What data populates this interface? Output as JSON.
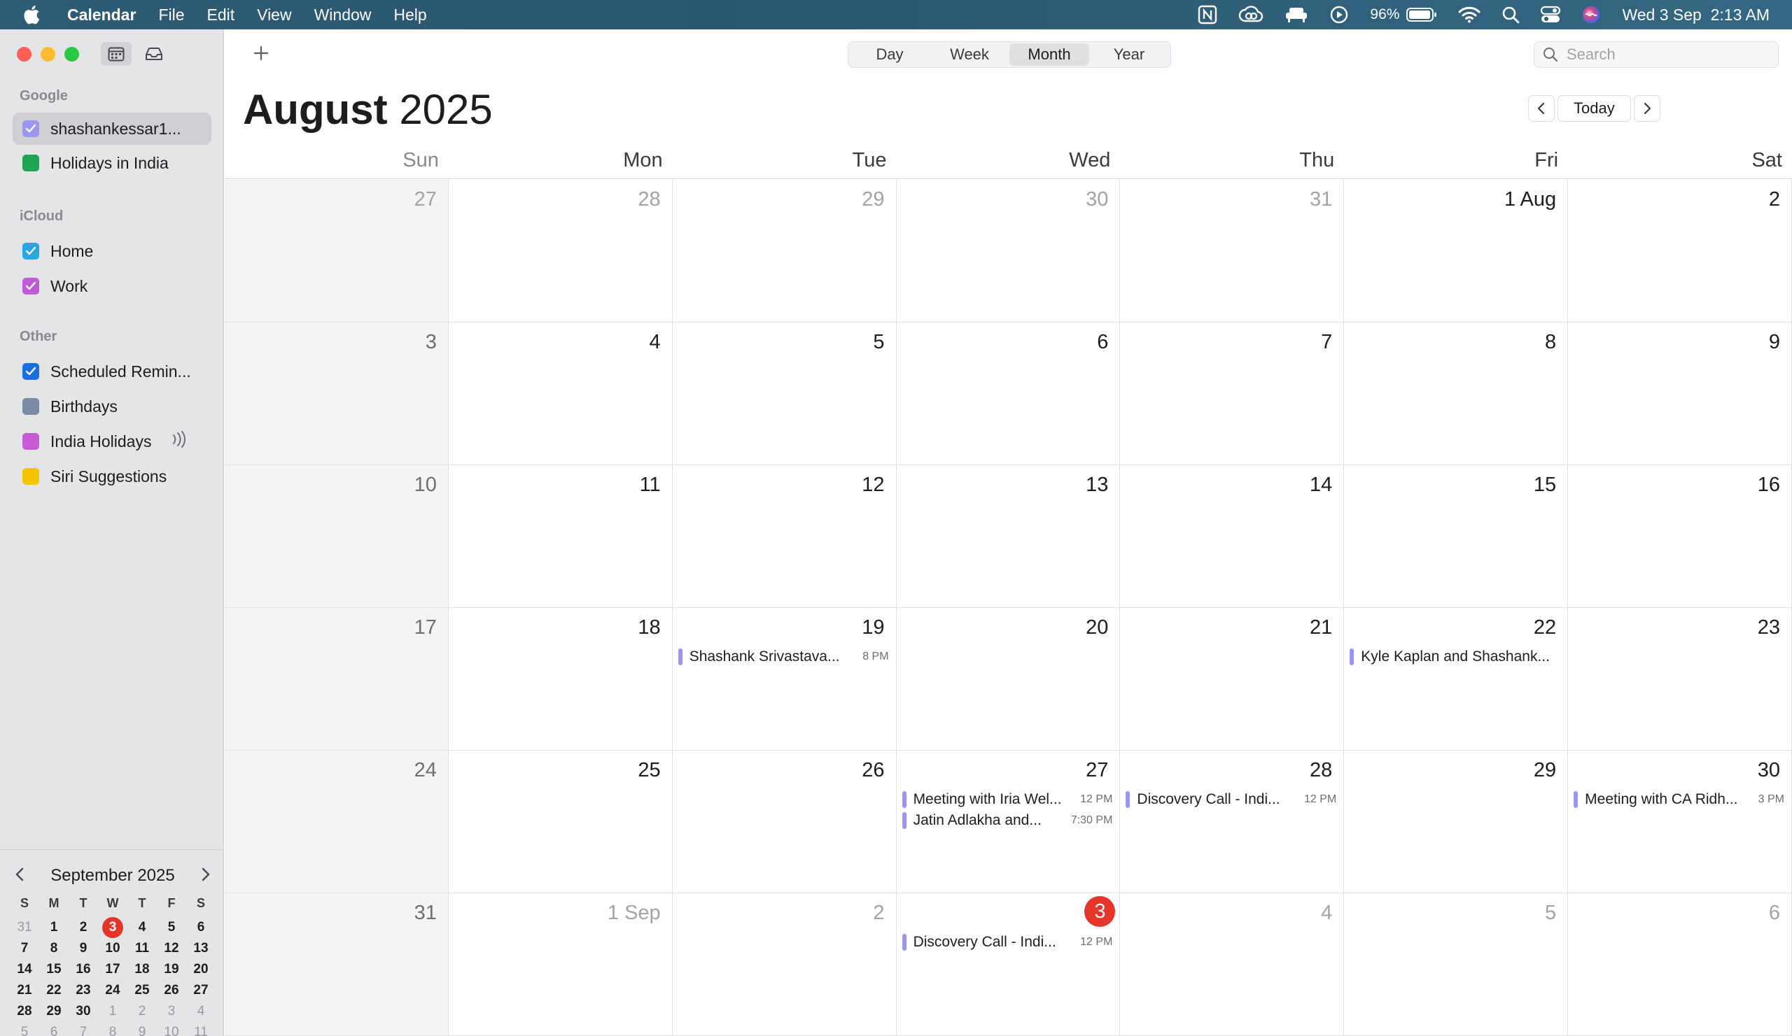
{
  "menubar": {
    "app_name": "Calendar",
    "menus": [
      "File",
      "Edit",
      "View",
      "Window",
      "Help"
    ],
    "battery_percent": "96%",
    "clock": "Wed 3 Sep  2:13 AM"
  },
  "sidebar": {
    "groups": [
      {
        "label": "Google",
        "items": [
          {
            "label": "shashankessar1...",
            "color": "#9b95f0",
            "checked": true,
            "selected": true
          },
          {
            "label": "Holidays in India",
            "color": "#1fa354",
            "checked": false
          }
        ]
      },
      {
        "label": "iCloud",
        "items": [
          {
            "label": "Home",
            "color": "#2aa6df",
            "checked": true
          },
          {
            "label": "Work",
            "color": "#c05ad8",
            "checked": true
          }
        ]
      },
      {
        "label": "Other",
        "items": [
          {
            "label": "Scheduled Remin...",
            "color": "#1a6fe0",
            "checked": true
          },
          {
            "label": "Birthdays",
            "color": "#7d8aa6",
            "checked": false
          },
          {
            "label": "India Holidays",
            "color": "#c85ad6",
            "checked": false,
            "broadcast": true
          },
          {
            "label": "Siri Suggestions",
            "color": "#f5c400",
            "checked": false
          }
        ]
      }
    ],
    "mini_calendar": {
      "title": "September 2025",
      "weekdays": [
        "S",
        "M",
        "T",
        "W",
        "T",
        "F",
        "S"
      ],
      "weeks": [
        [
          [
            "31",
            true
          ],
          [
            "1",
            false
          ],
          [
            "2",
            false
          ],
          [
            "3",
            false,
            true
          ],
          [
            "4",
            false
          ],
          [
            "5",
            false
          ],
          [
            "6",
            false
          ]
        ],
        [
          [
            "7",
            false
          ],
          [
            "8",
            false
          ],
          [
            "9",
            false
          ],
          [
            "10",
            false
          ],
          [
            "11",
            false
          ],
          [
            "12",
            false
          ],
          [
            "13",
            false
          ]
        ],
        [
          [
            "14",
            false
          ],
          [
            "15",
            false
          ],
          [
            "16",
            false
          ],
          [
            "17",
            false
          ],
          [
            "18",
            false
          ],
          [
            "19",
            false
          ],
          [
            "20",
            false
          ]
        ],
        [
          [
            "21",
            false
          ],
          [
            "22",
            false
          ],
          [
            "23",
            false
          ],
          [
            "24",
            false
          ],
          [
            "25",
            false
          ],
          [
            "26",
            false
          ],
          [
            "27",
            false
          ]
        ],
        [
          [
            "28",
            false
          ],
          [
            "29",
            false
          ],
          [
            "30",
            false
          ],
          [
            "1",
            true
          ],
          [
            "2",
            true
          ],
          [
            "3",
            true
          ],
          [
            "4",
            true
          ]
        ],
        [
          [
            "5",
            true
          ],
          [
            "6",
            true
          ],
          [
            "7",
            true
          ],
          [
            "8",
            true
          ],
          [
            "9",
            true
          ],
          [
            "10",
            true
          ],
          [
            "11",
            true
          ]
        ]
      ]
    }
  },
  "toolbar": {
    "views": [
      "Day",
      "Week",
      "Month",
      "Year"
    ],
    "active_view": "Month",
    "search_placeholder": "Search",
    "today_label": "Today"
  },
  "calendar": {
    "month_label": "August",
    "year_label": "2025",
    "weekdays": [
      "Sun",
      "Mon",
      "Tue",
      "Wed",
      "Thu",
      "Fri",
      "Sat"
    ],
    "weeks": [
      [
        {
          "d": "27",
          "out": true
        },
        {
          "d": "28",
          "out": true
        },
        {
          "d": "29",
          "out": true
        },
        {
          "d": "30",
          "out": true
        },
        {
          "d": "31",
          "out": true
        },
        {
          "d": "1 Aug"
        },
        {
          "d": "2"
        }
      ],
      [
        {
          "d": "3"
        },
        {
          "d": "4"
        },
        {
          "d": "5"
        },
        {
          "d": "6"
        },
        {
          "d": "7"
        },
        {
          "d": "8"
        },
        {
          "d": "9"
        }
      ],
      [
        {
          "d": "10"
        },
        {
          "d": "11"
        },
        {
          "d": "12"
        },
        {
          "d": "13"
        },
        {
          "d": "14"
        },
        {
          "d": "15"
        },
        {
          "d": "16"
        }
      ],
      [
        {
          "d": "17"
        },
        {
          "d": "18"
        },
        {
          "d": "19",
          "events": [
            {
              "title": "Shashank Srivastava...",
              "time": "8 PM"
            }
          ]
        },
        {
          "d": "20"
        },
        {
          "d": "21"
        },
        {
          "d": "22",
          "events": [
            {
              "title": "Kyle Kaplan and Shashank...",
              "time": ""
            }
          ]
        },
        {
          "d": "23"
        }
      ],
      [
        {
          "d": "24"
        },
        {
          "d": "25"
        },
        {
          "d": "26"
        },
        {
          "d": "27",
          "events": [
            {
              "title": "Meeting with Iria Wel...",
              "time": "12 PM"
            },
            {
              "title": "Jatin Adlakha and...",
              "time": "7:30 PM"
            }
          ]
        },
        {
          "d": "28",
          "events": [
            {
              "title": "Discovery Call - Indi...",
              "time": "12 PM"
            }
          ]
        },
        {
          "d": "29"
        },
        {
          "d": "30",
          "events": [
            {
              "title": "Meeting with CA Ridh...",
              "time": "3 PM"
            }
          ]
        }
      ],
      [
        {
          "d": "31"
        },
        {
          "d": "1 Sep",
          "out": true
        },
        {
          "d": "2",
          "out": true
        },
        {
          "d": "3",
          "out": true,
          "today": true,
          "events": [
            {
              "title": "Discovery Call - Indi...",
              "time": "12 PM"
            }
          ]
        },
        {
          "d": "4",
          "out": true
        },
        {
          "d": "5",
          "out": true
        },
        {
          "d": "6",
          "out": true
        }
      ]
    ]
  }
}
